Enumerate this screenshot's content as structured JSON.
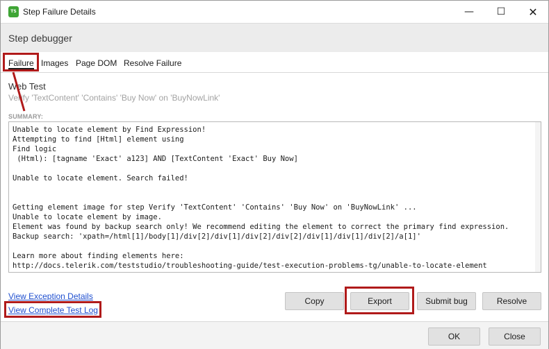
{
  "window": {
    "title": "Step Failure Details",
    "app_icon_text": "TS",
    "minimize_glyph": "—",
    "maximize_glyph": "☐",
    "close_glyph": "✕"
  },
  "header": {
    "title": "Step debugger"
  },
  "tabs": [
    {
      "label": "Failure",
      "active": true
    },
    {
      "label": "Images",
      "active": false
    },
    {
      "label": "Page DOM",
      "active": false
    },
    {
      "label": "Resolve Failure",
      "active": false
    }
  ],
  "step": {
    "test_name": "Web Test",
    "description": "Verify 'TextContent' 'Contains' 'Buy Now' on 'BuyNowLink'"
  },
  "summary": {
    "label": "SUMMARY:",
    "text": "Unable to locate element by Find Expression!\nAttempting to find [Html] element using\nFind logic\n (Html): [tagname 'Exact' a123] AND [TextContent 'Exact' Buy Now]\n\nUnable to locate element. Search failed!\n\n\nGetting element image for step Verify 'TextContent' 'Contains' 'Buy Now' on 'BuyNowLink' ...\nUnable to locate element by image.\nElement was found by backup search only! We recommend editing the element to correct the primary find expression.\nBackup search: 'xpath=/html[1]/body[1]/div[2]/div[1]/div[2]/div[2]/div[1]/div[1]/div[2]/a[1]'\n\nLearn more about finding elements here:\nhttp://docs.telerik.com/teststudio/troubleshooting-guide/test-execution-problems-tg/unable-to-locate-element"
  },
  "links": {
    "exception_details": "View Exception Details",
    "complete_log": "View Complete Test Log"
  },
  "actions": {
    "copy": "Copy",
    "export": "Export",
    "submit_bug": "Submit bug",
    "resolve": "Resolve"
  },
  "footer": {
    "ok": "OK",
    "close": "Close"
  },
  "colors": {
    "highlight": "#b01a1a",
    "link": "#1f4fcf",
    "app_icon": "#3fa535"
  }
}
